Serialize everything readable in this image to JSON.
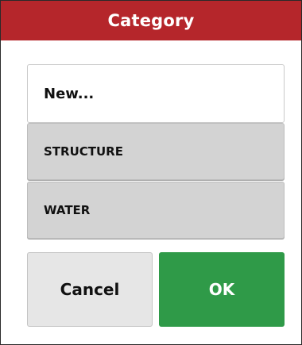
{
  "dialog": {
    "title": "Category"
  },
  "list": {
    "new_item": "New...",
    "options": [
      "STRUCTURE",
      "WATER"
    ]
  },
  "buttons": {
    "cancel_label": "Cancel",
    "ok_label": "OK"
  },
  "colors": {
    "titlebar": "#b5262b",
    "ok_button": "#2f9a48",
    "option_background": "#d3d3d3",
    "cancel_background": "#e6e6e6"
  }
}
